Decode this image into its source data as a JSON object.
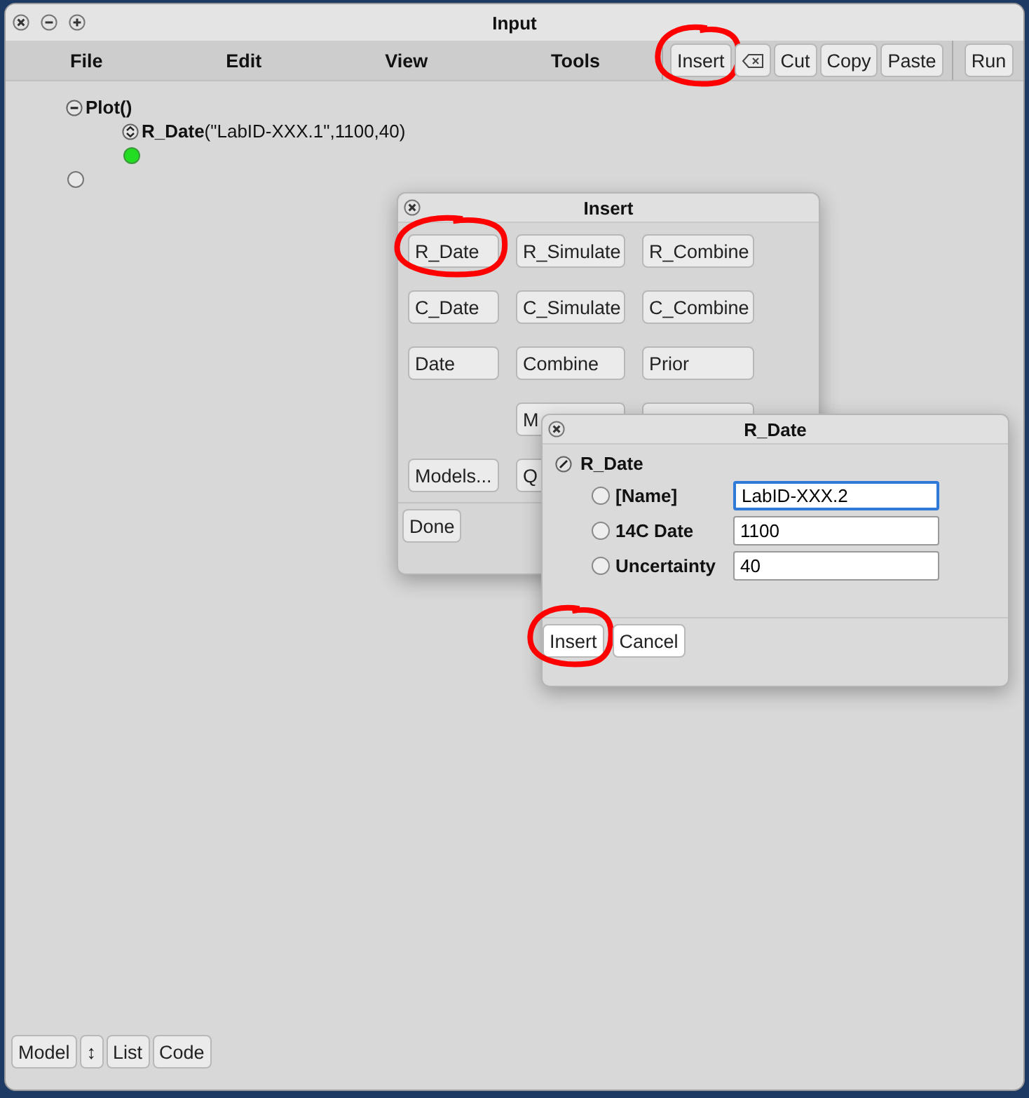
{
  "window": {
    "title": "Input"
  },
  "menu": [
    "File",
    "Edit",
    "View",
    "Tools"
  ],
  "toolbar": [
    {
      "kind": "button",
      "label": "Insert",
      "circled": true
    },
    {
      "kind": "delete",
      "circled": false
    },
    {
      "kind": "button",
      "label": "Cut",
      "circled": false
    },
    {
      "kind": "button",
      "label": "Copy",
      "circled": false
    },
    {
      "kind": "button",
      "label": "Paste",
      "circled": false
    },
    {
      "kind": "separator"
    },
    {
      "kind": "button",
      "label": "Run",
      "circled": false
    }
  ],
  "tree": [
    {
      "kind": "node",
      "text": "Plot()",
      "expanded": true,
      "children": [
        {
          "kind": "node",
          "text": "**R_Date**(\"LabID-XXX.1\",1100,40)",
          "expanded": false
        },
        {
          "kind": "slot",
          "selected": true
        }
      ]
    },
    {
      "kind": "slot",
      "selected": false
    }
  ],
  "insert_window": {
    "title": "Insert",
    "buttons": [
      {
        "kind": "button",
        "label": "R_Date",
        "circled": true
      },
      {
        "kind": "button",
        "label": "R_Simulate",
        "circled": false
      },
      {
        "kind": "button",
        "label": "R_Combine",
        "circled": false
      },
      {
        "kind": "button",
        "label": "C_Date",
        "circled": false
      },
      {
        "kind": "button",
        "label": "C_Simulate",
        "circled": false
      },
      {
        "kind": "button",
        "label": "C_Combine",
        "circled": false
      },
      {
        "kind": "button",
        "label": "Date",
        "circled": false
      },
      {
        "kind": "button",
        "label": "Combine",
        "circled": false
      },
      {
        "kind": "button",
        "label": "Prior",
        "circled": false
      },
      {
        "kind": "gap"
      },
      {
        "kind": "button",
        "label": "M",
        "circled": false
      },
      {
        "kind": "stub"
      },
      {
        "kind": "button",
        "label": "Models...",
        "circled": false
      },
      {
        "kind": "button",
        "label": "Q",
        "circled": false
      }
    ],
    "done": "Done"
  },
  "dialog": {
    "title": "R_Date",
    "heading": "R_Date",
    "fields": [
      {
        "label": "[Name]",
        "value": "LabID-XXX.2",
        "checked": false,
        "focused": true
      },
      {
        "label": "14C Date",
        "value": "1100",
        "checked": false,
        "focused": false
      },
      {
        "label": "Uncertainty",
        "value": "40",
        "checked": false,
        "focused": false
      }
    ],
    "buttons": [
      {
        "label": "Insert",
        "circled": true
      },
      {
        "label": "Cancel",
        "circled": false
      }
    ]
  },
  "bottom_bar": [
    {
      "label": "Model"
    },
    {
      "label": "↕"
    },
    {
      "label": "List"
    },
    {
      "label": "Code"
    }
  ]
}
